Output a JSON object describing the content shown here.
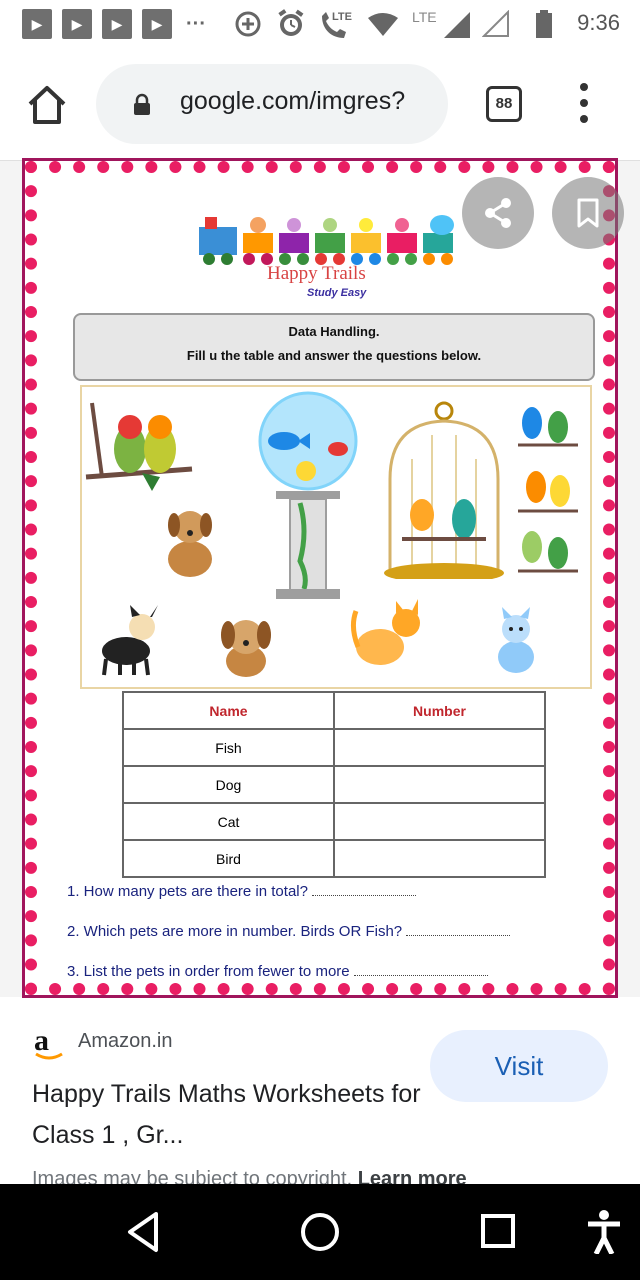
{
  "status_bar": {
    "time": "9:36",
    "lte_1": "LTE",
    "lte_2": "LTE",
    "dots": "···",
    "icons": [
      "notification-icon",
      "notification-icon",
      "notification-icon",
      "notification-icon",
      "add-circle-icon",
      "alarm-icon",
      "volte-call-icon",
      "wifi-icon",
      "signal-icon",
      "signal-empty-icon",
      "battery-icon"
    ]
  },
  "browser": {
    "url": "google.com/imgres?",
    "tab_count": "88"
  },
  "worksheet": {
    "brand": "Happy Trails",
    "brand_sub": "Study Easy",
    "instruction_title": "Data Handling.",
    "instruction_text": "Fill u the table and answer the questions below.",
    "table": {
      "headers": [
        "Name",
        "Number"
      ],
      "rows": [
        [
          "Fish",
          ""
        ],
        [
          "Dog",
          ""
        ],
        [
          "Cat",
          ""
        ],
        [
          "Bird",
          ""
        ]
      ]
    },
    "questions": [
      "1. How many pets are there in total?",
      "2. Which pets are more in number. Birds OR Fish?",
      "3. List the pets in order from fewer to more"
    ]
  },
  "result": {
    "source": "Amazon.in",
    "visit": "Visit",
    "title": "Happy Trails Maths Worksheets for Class 1 , Gr...",
    "copyright": "Images may be subject to copyright.",
    "learn_more": "Learn more"
  },
  "colors": {
    "border_pink": "#e91e63",
    "visit_bg": "#e8f0fe",
    "visit_text": "#1a5fb4",
    "header_red": "#c0262d",
    "question_blue": "#1a237e"
  }
}
